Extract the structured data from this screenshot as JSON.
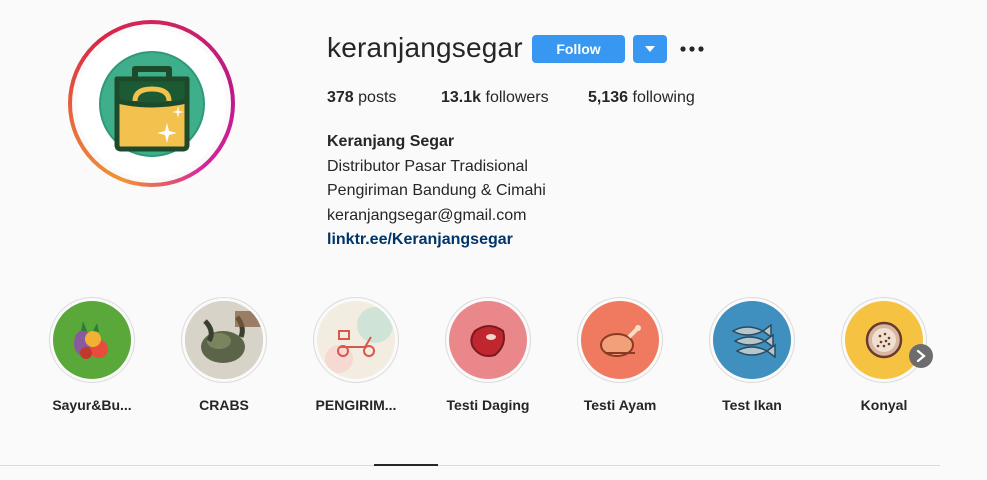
{
  "profile": {
    "username": "keranjangsegar",
    "follow_label": "Follow",
    "posts_count": "378",
    "posts_label": "posts",
    "followers_count": "13.1k",
    "followers_label": "followers",
    "following_count": "5,136",
    "following_label": "following",
    "full_name": "Keranjang Segar",
    "bio_lines": [
      "Distributor Pasar Tradisional",
      "Pengiriman Bandung & Cimahi",
      "keranjangsegar@gmail.com"
    ],
    "link": "linktr.ee/Keranjangsegar"
  },
  "highlights": [
    {
      "label": "Sayur&Bu...",
      "icon": "vegetables-icon",
      "bg": "#5aa83a"
    },
    {
      "label": "CRABS",
      "icon": "crab-photo",
      "bg": "#7a8a6a"
    },
    {
      "label": "PENGIRIM...",
      "icon": "delivery-scooter-icon",
      "bg": "#f3ece0"
    },
    {
      "label": "Testi Daging",
      "icon": "meat-icon",
      "bg": "#e9878a"
    },
    {
      "label": "Testi Ayam",
      "icon": "chicken-icon",
      "bg": "#ef7a5f"
    },
    {
      "label": "Test Ikan",
      "icon": "fish-icon",
      "bg": "#3f8fbf"
    },
    {
      "label": "Konyal",
      "icon": "passion-fruit-icon",
      "bg": "#f5c242"
    }
  ],
  "colors": {
    "accent": "#3897f0",
    "link": "#003569",
    "background": "#fafafa"
  }
}
